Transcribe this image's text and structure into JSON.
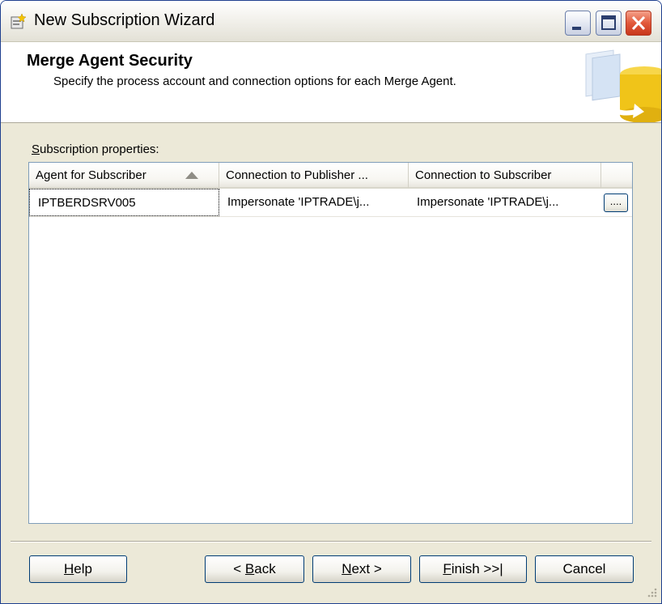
{
  "window": {
    "title": "New Subscription Wizard"
  },
  "header": {
    "title": "Merge Agent Security",
    "subtitle": "Specify the process account and connection options for each Merge Agent."
  },
  "section": {
    "label_first": "S",
    "label_rest": "ubscription properties:"
  },
  "grid": {
    "columns": [
      "Agent for Subscriber",
      "Connection to Publisher ...",
      "Connection to Subscriber",
      ""
    ],
    "rows": [
      {
        "agent": "IPTBERDSRV005",
        "publisher_conn": "Impersonate 'IPTRADE\\j...",
        "subscriber_conn": "Impersonate 'IPTRADE\\j...",
        "button_label": "...."
      }
    ]
  },
  "buttons": {
    "help": {
      "u": "H",
      "rest": "elp"
    },
    "back": {
      "pre": "< ",
      "u": "B",
      "rest": "ack"
    },
    "next": {
      "u": "N",
      "rest": "ext >"
    },
    "finish": {
      "u": "F",
      "rest": "inish >>|"
    },
    "cancel": {
      "label": "Cancel"
    }
  },
  "icons": {
    "app": "wizard-app-icon",
    "sort": "sort-ascending-icon",
    "header_art": "database-sync-icon",
    "grip": "resize-grip-icon"
  }
}
